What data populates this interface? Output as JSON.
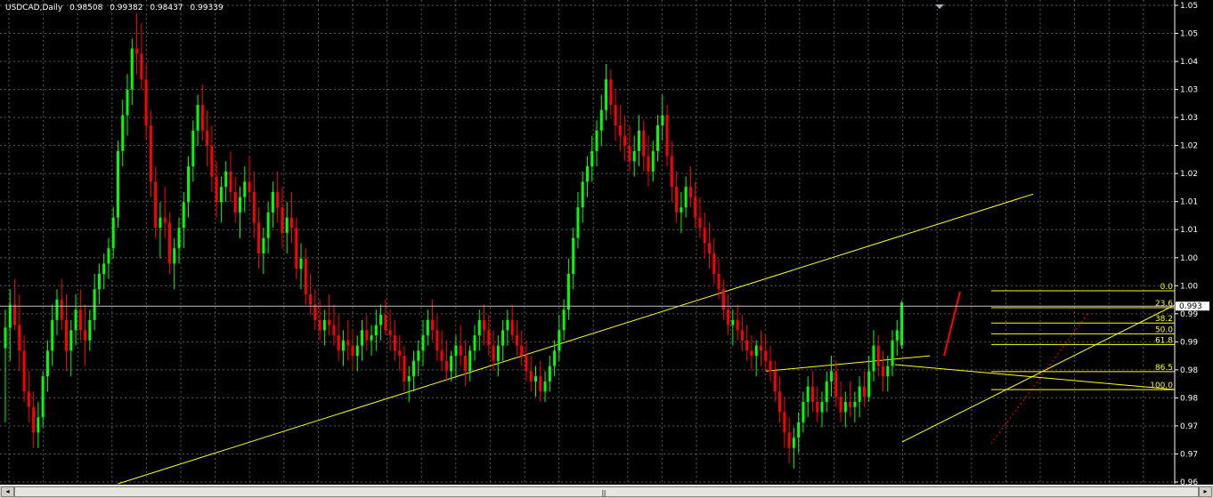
{
  "header": {
    "symbol": "USDCAD,Daily",
    "open": "0.98508",
    "high": "0.99382",
    "low": "0.98437",
    "close": "0.99339"
  },
  "colors": {
    "background": "#000000",
    "bull": "#00ff00",
    "bear": "#ff0000",
    "grid": "#808080",
    "line": "#ffff00",
    "axis_text": "#ffffff",
    "price_badge_bg": "#ffffff"
  },
  "chart_data": {
    "type": "candlestick",
    "y_range": [
      0.958,
      1.0525
    ],
    "y_ticks": [
      "1.05",
      "1.05",
      "1.04",
      "1.03",
      "1.03",
      "1.02",
      "1.02",
      "1.01",
      "1.01",
      "1.00",
      "1.00",
      "0.99",
      "0.99",
      "0.98",
      "0.98",
      "0.97",
      "0.97",
      "0.96"
    ],
    "current_price": "0.993",
    "candles": [
      [
        0.9845,
        0.992,
        0.97,
        0.9885
      ],
      [
        0.9885,
        0.996,
        0.982,
        0.993
      ],
      [
        0.993,
        0.998,
        0.988,
        0.989
      ],
      [
        0.989,
        0.995,
        0.98,
        0.984
      ],
      [
        0.984,
        0.987,
        0.974,
        0.976
      ],
      [
        0.976,
        0.98,
        0.97,
        0.973
      ],
      [
        0.973,
        0.976,
        0.965,
        0.968
      ],
      [
        0.968,
        0.974,
        0.965,
        0.971
      ],
      [
        0.971,
        0.98,
        0.969,
        0.979
      ],
      [
        0.979,
        0.986,
        0.976,
        0.984
      ],
      [
        0.984,
        0.993,
        0.981,
        0.99
      ],
      [
        0.99,
        0.996,
        0.987,
        0.994
      ],
      [
        0.994,
        0.998,
        0.988,
        0.99
      ],
      [
        0.99,
        0.995,
        0.98,
        0.984
      ],
      [
        0.984,
        0.99,
        0.979,
        0.988
      ],
      [
        0.988,
        0.995,
        0.985,
        0.992
      ],
      [
        0.992,
        0.996,
        0.986,
        0.988
      ],
      [
        0.988,
        0.993,
        0.981,
        0.986
      ],
      [
        0.986,
        0.992,
        0.984,
        0.99
      ],
      [
        0.99,
        0.999,
        0.988,
        0.996
      ],
      [
        0.996,
        1.001,
        0.993,
        0.999
      ],
      [
        0.999,
        1.003,
        0.996,
        1.001
      ],
      [
        1.001,
        1.006,
        0.998,
        1.004
      ],
      [
        1.004,
        1.012,
        1.002,
        1.01
      ],
      [
        1.01,
        1.025,
        1.008,
        1.023
      ],
      [
        1.023,
        1.033,
        1.02,
        1.03
      ],
      [
        1.03,
        1.038,
        1.026,
        1.035
      ],
      [
        1.035,
        1.045,
        1.032,
        1.043
      ],
      [
        1.043,
        1.05,
        1.038,
        1.042
      ],
      [
        1.042,
        1.048,
        1.035,
        1.037
      ],
      [
        1.037,
        1.04,
        1.025,
        1.028
      ],
      [
        1.028,
        1.031,
        1.014,
        1.017
      ],
      [
        1.017,
        1.02,
        1.006,
        1.008
      ],
      [
        1.008,
        1.013,
        1.002,
        1.01
      ],
      [
        1.01,
        1.016,
        1.006,
        1.009
      ],
      [
        1.009,
        1.011,
        0.999,
        1.001
      ],
      [
        1.001,
        1.006,
        0.996,
        1.004
      ],
      [
        1.004,
        1.01,
        1.001,
        1.008
      ],
      [
        1.008,
        1.015,
        1.004,
        1.013
      ],
      [
        1.013,
        1.022,
        1.01,
        1.02
      ],
      [
        1.02,
        1.029,
        1.017,
        1.027
      ],
      [
        1.027,
        1.034,
        1.024,
        1.032
      ],
      [
        1.032,
        1.036,
        1.025,
        1.027
      ],
      [
        1.027,
        1.031,
        1.02,
        1.024
      ],
      [
        1.024,
        1.028,
        1.015,
        1.018
      ],
      [
        1.018,
        1.021,
        1.01,
        1.013
      ],
      [
        1.013,
        1.018,
        1.009,
        1.016
      ],
      [
        1.016,
        1.021,
        1.013,
        1.019
      ],
      [
        1.019,
        1.023,
        1.013,
        1.015
      ],
      [
        1.015,
        1.018,
        1.009,
        1.011
      ],
      [
        1.011,
        1.016,
        1.006,
        1.014
      ],
      [
        1.014,
        1.02,
        1.011,
        1.017
      ],
      [
        1.017,
        1.022,
        1.013,
        1.015
      ],
      [
        1.015,
        1.019,
        1.006,
        1.009
      ],
      [
        1.009,
        1.012,
        1.0,
        1.003
      ],
      [
        1.003,
        1.008,
        0.999,
        1.006
      ],
      [
        1.006,
        1.013,
        1.003,
        1.011
      ],
      [
        1.011,
        1.017,
        1.008,
        1.015
      ],
      [
        1.015,
        1.019,
        1.009,
        1.012
      ],
      [
        1.012,
        1.016,
        1.004,
        1.007
      ],
      [
        1.007,
        1.013,
        1.003,
        1.01
      ],
      [
        1.01,
        1.015,
        1.005,
        1.008
      ],
      [
        1.008,
        1.01,
        0.998,
        1.0
      ],
      [
        1.0,
        1.005,
        0.996,
        1.002
      ],
      [
        1.002,
        1.004,
        0.993,
        0.995
      ],
      [
        0.995,
        0.999,
        0.991,
        0.993
      ],
      [
        0.993,
        0.996,
        0.988,
        0.99
      ],
      [
        0.99,
        0.994,
        0.986,
        0.988
      ],
      [
        0.988,
        0.992,
        0.985,
        0.99
      ],
      [
        0.99,
        0.995,
        0.987,
        0.989
      ],
      [
        0.989,
        0.993,
        0.985,
        0.987
      ],
      [
        0.987,
        0.991,
        0.982,
        0.984
      ],
      [
        0.984,
        0.988,
        0.981,
        0.986
      ],
      [
        0.986,
        0.99,
        0.982,
        0.985
      ],
      [
        0.985,
        0.988,
        0.98,
        0.983
      ],
      [
        0.983,
        0.987,
        0.98,
        0.985
      ],
      [
        0.985,
        0.99,
        0.982,
        0.988
      ],
      [
        0.988,
        0.991,
        0.984,
        0.986
      ],
      [
        0.986,
        0.989,
        0.983,
        0.987
      ],
      [
        0.987,
        0.992,
        0.984,
        0.989
      ],
      [
        0.989,
        0.993,
        0.986,
        0.991
      ],
      [
        0.991,
        0.994,
        0.987,
        0.988
      ],
      [
        0.988,
        0.992,
        0.984,
        0.987
      ],
      [
        0.987,
        0.99,
        0.982,
        0.984
      ],
      [
        0.984,
        0.987,
        0.98,
        0.983
      ],
      [
        0.983,
        0.985,
        0.976,
        0.978
      ],
      [
        0.978,
        0.981,
        0.974,
        0.979
      ],
      [
        0.979,
        0.984,
        0.976,
        0.982
      ],
      [
        0.982,
        0.986,
        0.979,
        0.984
      ],
      [
        0.984,
        0.99,
        0.981,
        0.987
      ],
      [
        0.987,
        0.992,
        0.985,
        0.99
      ],
      [
        0.99,
        0.994,
        0.986,
        0.988
      ],
      [
        0.988,
        0.991,
        0.982,
        0.984
      ],
      [
        0.984,
        0.988,
        0.98,
        0.982
      ],
      [
        0.982,
        0.986,
        0.978,
        0.98
      ],
      [
        0.98,
        0.984,
        0.978,
        0.983
      ],
      [
        0.983,
        0.987,
        0.979,
        0.985
      ],
      [
        0.985,
        0.989,
        0.981,
        0.983
      ],
      [
        0.983,
        0.986,
        0.977,
        0.98
      ],
      [
        0.98,
        0.985,
        0.978,
        0.984
      ],
      [
        0.984,
        0.989,
        0.982,
        0.987
      ],
      [
        0.987,
        0.992,
        0.984,
        0.99
      ],
      [
        0.99,
        0.993,
        0.985,
        0.988
      ],
      [
        0.988,
        0.991,
        0.983,
        0.985
      ],
      [
        0.985,
        0.988,
        0.98,
        0.982
      ],
      [
        0.982,
        0.987,
        0.979,
        0.985
      ],
      [
        0.985,
        0.99,
        0.982,
        0.988
      ],
      [
        0.988,
        0.992,
        0.985,
        0.99
      ],
      [
        0.99,
        0.993,
        0.986,
        0.987
      ],
      [
        0.987,
        0.99,
        0.983,
        0.985
      ],
      [
        0.985,
        0.988,
        0.981,
        0.983
      ],
      [
        0.983,
        0.986,
        0.978,
        0.98
      ],
      [
        0.98,
        0.983,
        0.976,
        0.978
      ],
      [
        0.978,
        0.981,
        0.975,
        0.979
      ],
      [
        0.979,
        0.982,
        0.974,
        0.976
      ],
      [
        0.976,
        0.98,
        0.974,
        0.978
      ],
      [
        0.978,
        0.983,
        0.976,
        0.981
      ],
      [
        0.981,
        0.986,
        0.979,
        0.984
      ],
      [
        0.984,
        0.991,
        0.982,
        0.988
      ],
      [
        0.988,
        0.994,
        0.986,
        0.992
      ],
      [
        0.992,
        1.002,
        0.99,
        0.999
      ],
      [
        0.999,
        1.008,
        0.996,
        1.006
      ],
      [
        1.006,
        1.015,
        1.004,
        1.012
      ],
      [
        1.012,
        1.019,
        1.009,
        1.017
      ],
      [
        1.017,
        1.022,
        1.014,
        1.02
      ],
      [
        1.02,
        1.026,
        1.017,
        1.023
      ],
      [
        1.023,
        1.029,
        1.02,
        1.027
      ],
      [
        1.027,
        1.034,
        1.024,
        1.031
      ],
      [
        1.031,
        1.04,
        1.029,
        1.037
      ],
      [
        1.037,
        1.039,
        1.03,
        1.032
      ],
      [
        1.032,
        1.035,
        1.025,
        1.028
      ],
      [
        1.028,
        1.032,
        1.023,
        1.026
      ],
      [
        1.026,
        1.03,
        1.021,
        1.024
      ],
      [
        1.024,
        1.028,
        1.019,
        1.021
      ],
      [
        1.021,
        1.026,
        1.018,
        1.023
      ],
      [
        1.023,
        1.03,
        1.02,
        1.027
      ],
      [
        1.027,
        1.029,
        1.019,
        1.022
      ],
      [
        1.022,
        1.026,
        1.016,
        1.019
      ],
      [
        1.019,
        1.025,
        1.017,
        1.023
      ],
      [
        1.023,
        1.03,
        1.021,
        1.028
      ],
      [
        1.028,
        1.034,
        1.025,
        1.03
      ],
      [
        1.03,
        1.032,
        1.02,
        1.022
      ],
      [
        1.022,
        1.025,
        1.013,
        1.016
      ],
      [
        1.016,
        1.019,
        1.009,
        1.011
      ],
      [
        1.011,
        1.015,
        1.007,
        1.012
      ],
      [
        1.012,
        1.018,
        1.01,
        1.016
      ],
      [
        1.016,
        1.02,
        1.012,
        1.014
      ],
      [
        1.014,
        1.017,
        1.008,
        1.01
      ],
      [
        1.01,
        1.014,
        1.006,
        1.008
      ],
      [
        1.008,
        1.011,
        1.002,
        1.005
      ],
      [
        1.005,
        1.009,
        1.0,
        1.003
      ],
      [
        1.003,
        1.006,
        0.997,
        0.999
      ],
      [
        0.999,
        1.002,
        0.994,
        0.996
      ],
      [
        0.996,
        0.998,
        0.99,
        0.992
      ],
      [
        0.992,
        0.995,
        0.987,
        0.989
      ],
      [
        0.989,
        0.992,
        0.985,
        0.99
      ],
      [
        0.99,
        0.993,
        0.986,
        0.988
      ],
      [
        0.988,
        0.991,
        0.984,
        0.986
      ],
      [
        0.986,
        0.989,
        0.982,
        0.984
      ],
      [
        0.984,
        0.987,
        0.98,
        0.983
      ],
      [
        0.983,
        0.986,
        0.979,
        0.985
      ],
      [
        0.985,
        0.988,
        0.981,
        0.984
      ],
      [
        0.984,
        0.987,
        0.98,
        0.982
      ],
      [
        0.982,
        0.985,
        0.978,
        0.98
      ],
      [
        0.98,
        0.982,
        0.974,
        0.976
      ],
      [
        0.976,
        0.979,
        0.97,
        0.972
      ],
      [
        0.972,
        0.975,
        0.965,
        0.968
      ],
      [
        0.968,
        0.971,
        0.962,
        0.965
      ],
      [
        0.965,
        0.969,
        0.961,
        0.967
      ],
      [
        0.967,
        0.972,
        0.964,
        0.97
      ],
      [
        0.97,
        0.976,
        0.968,
        0.974
      ],
      [
        0.974,
        0.979,
        0.971,
        0.977
      ],
      [
        0.977,
        0.98,
        0.972,
        0.974
      ],
      [
        0.974,
        0.977,
        0.97,
        0.972
      ],
      [
        0.972,
        0.976,
        0.969,
        0.974
      ],
      [
        0.974,
        0.98,
        0.972,
        0.978
      ],
      [
        0.978,
        0.983,
        0.975,
        0.98
      ],
      [
        0.98,
        0.982,
        0.973,
        0.975
      ],
      [
        0.975,
        0.978,
        0.97,
        0.972
      ],
      [
        0.972,
        0.976,
        0.969,
        0.974
      ],
      [
        0.974,
        0.978,
        0.971,
        0.973
      ],
      [
        0.973,
        0.976,
        0.97,
        0.974
      ],
      [
        0.974,
        0.979,
        0.971,
        0.977
      ],
      [
        0.977,
        0.98,
        0.973,
        0.975
      ],
      [
        0.975,
        0.983,
        0.974,
        0.98
      ],
      [
        0.98,
        0.988,
        0.978,
        0.985
      ],
      [
        0.985,
        0.987,
        0.979,
        0.981
      ],
      [
        0.981,
        0.984,
        0.976,
        0.979
      ],
      [
        0.979,
        0.983,
        0.976,
        0.981
      ],
      [
        0.981,
        0.988,
        0.979,
        0.986
      ],
      [
        0.986,
        0.99,
        0.983,
        0.988
      ],
      [
        0.985,
        0.9938,
        0.9844,
        0.9934
      ]
    ],
    "horizontal_line": 0.9927,
    "trendlines": [
      {
        "from": [
          [
            24,
            0.958
          ]
        ],
        "to": [
          [
            219,
            1.0146
          ]
        ]
      },
      {
        "from": [
          [
            162,
            0.98
          ]
        ],
        "to": [
          [
            197,
            0.983
          ]
        ]
      }
    ],
    "fibonacci": {
      "levels": [
        {
          "label": "0.0",
          "price": 0.9957
        },
        {
          "label": "23.6",
          "price": 0.9924
        },
        {
          "label": "38.2",
          "price": 0.9894
        },
        {
          "label": "50.0",
          "price": 0.9873
        },
        {
          "label": "61.8",
          "price": 0.9852
        },
        {
          "label": "86.5",
          "price": 0.9799
        },
        {
          "label": "100.0",
          "price": 0.9764
        }
      ]
    }
  }
}
